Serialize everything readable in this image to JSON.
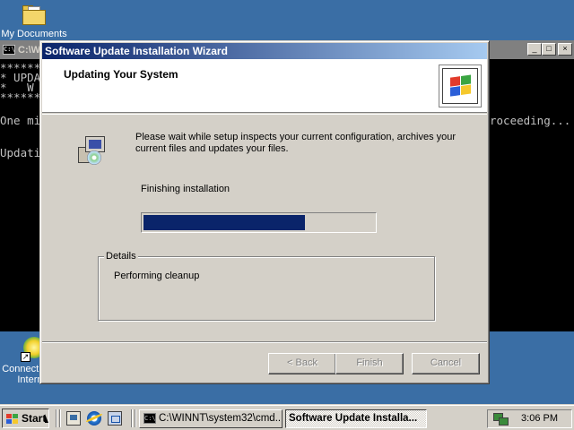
{
  "desktop": {
    "icons": [
      {
        "label": "My Documents",
        "icon": "folder-icon"
      },
      {
        "label": "Connect to the Internet",
        "icon": "internet-connect-icon"
      }
    ],
    "background": "#3a6ea5"
  },
  "console": {
    "title": "C:\\WINNT\\system32\\cmd.exe",
    "title_visible": "C:\\W",
    "lines_left": [
      "**********",
      "* UPDA",
      "*   W",
      "**********",
      "",
      "One mi",
      "",
      "Updati"
    ],
    "line_right": "roceeding..."
  },
  "wizard": {
    "title": "Software Update Installation Wizard",
    "header_title": "Updating Your System",
    "message": "Please wait while setup inspects your current configuration, archives your current files and updates your files.",
    "status": "Finishing installation",
    "progress": 0.7,
    "details_label": "Details",
    "details_text": "Performing cleanup",
    "buttons": {
      "back": "< Back",
      "finish": "Finish",
      "cancel": "Cancel"
    }
  },
  "taskbar": {
    "start_label": "Start",
    "quick_launch": [
      "show-desktop-icon",
      "internet-explorer-icon",
      "outlook-express-icon"
    ],
    "tasks": [
      {
        "label": "C:\\WINNT\\system32\\cmd...",
        "active": false
      },
      {
        "label": "Software Update Installa...",
        "active": true
      }
    ],
    "clock": "3:06 PM"
  }
}
